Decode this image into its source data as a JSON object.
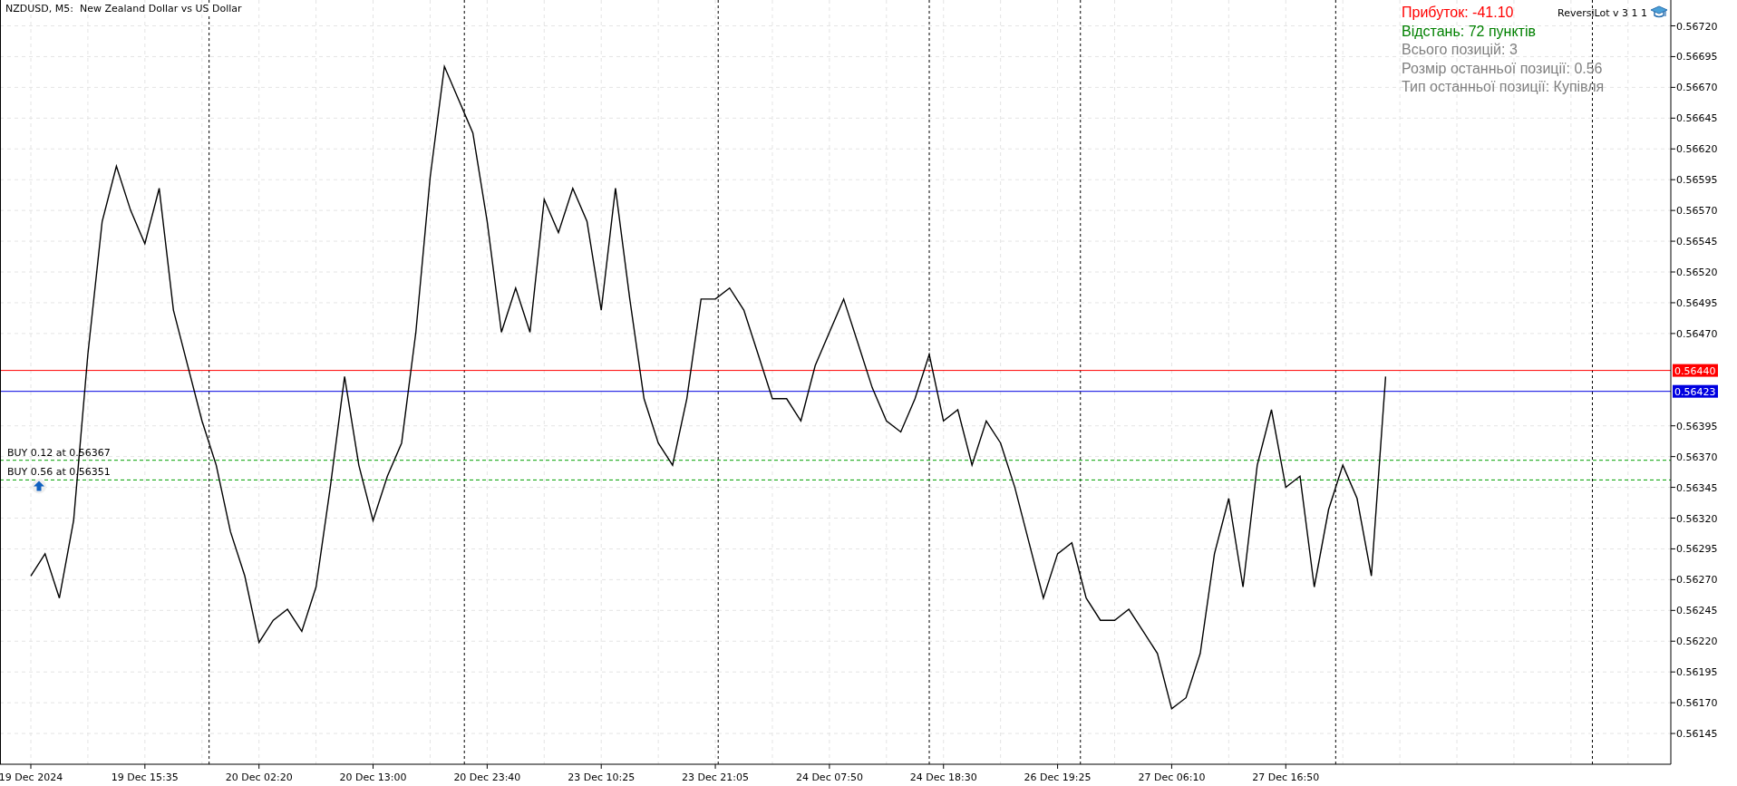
{
  "title": "NZDUSD, M5:  New Zealand Dollar vs US Dollar",
  "info": {
    "lines": [
      {
        "text": "Прибуток: -41.10",
        "color": "#ff0000"
      },
      {
        "text": "Відстань: 72 пунктів",
        "color": "#008000"
      },
      {
        "text": "Всього позицій: 3",
        "color": "#808080"
      },
      {
        "text": "Розмір останньої позиції: 0.56",
        "color": "#808080"
      },
      {
        "text": "Тип останньої позиції: Купівля",
        "color": "#808080"
      }
    ],
    "expert": "ReversiLot v 3 1 1"
  },
  "chart_data": {
    "type": "line",
    "grid": true,
    "categories": [
      "19 Dec 2024",
      null,
      null,
      null,
      null,
      null,
      null,
      null,
      "19 Dec 15:35",
      null,
      null,
      null,
      null,
      null,
      null,
      null,
      "20 Dec 02:20",
      null,
      null,
      null,
      null,
      null,
      null,
      null,
      "20 Dec 13:00",
      null,
      null,
      null,
      null,
      null,
      null,
      null,
      "20 Dec 23:40",
      null,
      null,
      null,
      null,
      null,
      null,
      null,
      "23 Dec 10:25",
      null,
      null,
      null,
      null,
      null,
      null,
      null,
      "23 Dec 21:05",
      null,
      null,
      null,
      null,
      null,
      null,
      null,
      "24 Dec 07:50",
      null,
      null,
      null,
      null,
      null,
      null,
      null,
      "24 Dec 18:30",
      null,
      null,
      null,
      null,
      null,
      null,
      null,
      "26 Dec 19:25",
      null,
      null,
      null,
      null,
      null,
      null,
      null,
      "27 Dec 06:10",
      null,
      null,
      null,
      null,
      null,
      null,
      null,
      "27 Dec 16:50",
      null,
      null,
      null,
      null,
      null,
      null,
      null,
      null,
      null,
      null,
      null,
      null,
      null,
      null,
      null,
      null,
      null,
      null,
      null,
      null,
      null,
      null,
      null,
      null,
      null,
      null,
      null
    ],
    "series": [
      {
        "color": "#000000",
        "values": [
          0.56273,
          0.56291,
          0.56255,
          0.56318,
          0.56453,
          0.56561,
          0.56606,
          0.5657,
          0.56543,
          0.56588,
          0.56489,
          0.56444,
          0.56399,
          0.56363,
          0.56309,
          0.56273,
          0.56219,
          0.56237,
          0.56246,
          0.56228,
          0.56264,
          0.56345,
          0.56435,
          0.56363,
          0.56318,
          0.56354,
          0.56381,
          0.56471,
          0.56597,
          0.56687,
          0.5666,
          0.56633,
          0.56561,
          0.56471,
          0.56507,
          0.56471,
          0.56579,
          0.56552,
          0.56588,
          0.56561,
          0.56489,
          0.56588,
          0.56498,
          0.56417,
          0.56381,
          0.56363,
          0.56417,
          0.56498,
          0.56498,
          0.56507,
          0.56489,
          0.56453,
          0.56417,
          0.56417,
          0.56399,
          0.56444,
          0.56471,
          0.56498,
          0.56462,
          0.56426,
          0.56399,
          0.5639,
          0.56417,
          0.56453,
          0.56399,
          0.56408,
          0.56363,
          0.56399,
          0.56381,
          0.56345,
          0.563,
          0.56255,
          0.56291,
          0.563,
          0.56255,
          0.56237,
          0.56237,
          0.56246,
          0.56228,
          0.5621,
          0.56165,
          0.56174,
          0.5621,
          0.56291,
          0.56336,
          0.56264,
          0.56363,
          0.56408,
          0.56345,
          0.56354,
          0.56264,
          0.56327,
          0.56363,
          0.56336,
          0.56273,
          0.56435,
          null,
          null,
          null,
          null,
          null,
          null,
          null,
          null,
          null,
          null,
          null,
          null,
          null,
          null,
          null,
          null,
          null,
          null,
          null,
          null
        ]
      }
    ],
    "ylim": [
      0.5612,
      0.56741
    ],
    "yticks": [
      {
        "value": 0.5672,
        "label": "0.56720"
      },
      {
        "value": 0.56695,
        "label": "0.56695"
      },
      {
        "value": 0.5667,
        "label": "0.56670"
      },
      {
        "value": 0.56645,
        "label": "0.56645"
      },
      {
        "value": 0.5662,
        "label": "0.56620"
      },
      {
        "value": 0.56595,
        "label": "0.56595"
      },
      {
        "value": 0.5657,
        "label": "0.56570"
      },
      {
        "value": 0.56545,
        "label": "0.56545"
      },
      {
        "value": 0.5652,
        "label": "0.56520"
      },
      {
        "value": 0.56495,
        "label": "0.56495"
      },
      {
        "value": 0.5647,
        "label": "0.56470"
      },
      {
        "value": 0.56395,
        "label": "0.56395"
      },
      {
        "value": 0.5637,
        "label": "0.56370"
      },
      {
        "value": 0.56345,
        "label": "0.56345"
      },
      {
        "value": 0.5632,
        "label": "0.56320"
      },
      {
        "value": 0.56295,
        "label": "0.56295"
      },
      {
        "value": 0.5627,
        "label": "0.56270"
      },
      {
        "value": 0.56245,
        "label": "0.56245"
      },
      {
        "value": 0.5622,
        "label": "0.56220"
      },
      {
        "value": 0.56195,
        "label": "0.56195"
      },
      {
        "value": 0.5617,
        "label": "0.56170"
      },
      {
        "value": 0.56145,
        "label": "0.56145"
      }
    ],
    "annotations": [
      "BUY 0.12 at 0.56367",
      "BUY 0.56 at 0.56351"
    ],
    "ref_lines": [
      {
        "axis": "y",
        "value": 0.56367,
        "color": "#00a000"
      },
      {
        "axis": "y",
        "value": 0.56351,
        "color": "#00a000"
      },
      {
        "axis": "y",
        "value": 0.5644,
        "color": "#ff0000",
        "label": "0.56440"
      },
      {
        "axis": "y",
        "value": 0.56423,
        "color": "#0000e0",
        "label": "0.56423"
      }
    ]
  }
}
